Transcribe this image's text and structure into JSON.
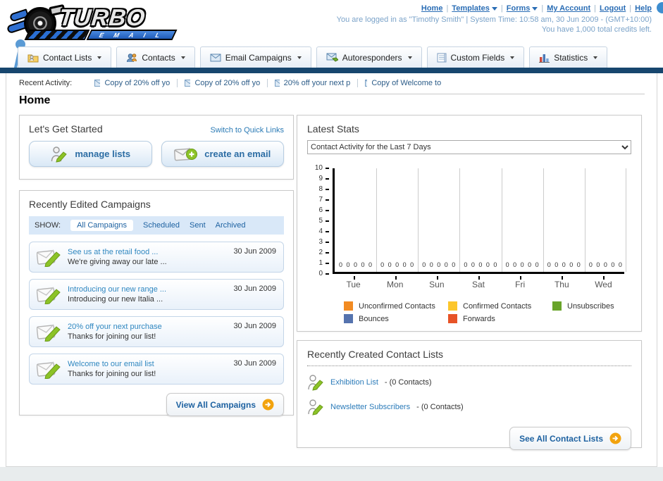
{
  "header": {
    "logo": {
      "title": "TURBO",
      "subtitle": "E M A I L"
    },
    "nav_links": [
      {
        "label": "Home"
      },
      {
        "label": "Templates",
        "dropdown": true
      },
      {
        "label": "Forms",
        "dropdown": true
      },
      {
        "label": "My Account"
      },
      {
        "label": "Logout"
      },
      {
        "label": "Help"
      }
    ],
    "separator": "|",
    "login_info": "You are logged in as \"Timothy Smith\" | System Time: 10:58 am, 30 Jun 2009 - (GMT+10:00)",
    "credits_info": "You have 1,000 total credits left."
  },
  "nav_tabs": [
    {
      "label": "Contact Lists",
      "icon": "contact-lists-folder-icon"
    },
    {
      "label": "Contacts",
      "icon": "contacts-people-icon"
    },
    {
      "label": "Email Campaigns",
      "icon": "email-envelope-icon"
    },
    {
      "label": "Autoresponders",
      "icon": "autoresponder-envelope-icon"
    },
    {
      "label": "Custom Fields",
      "icon": "custom-fields-document-icon"
    },
    {
      "label": "Statistics",
      "icon": "statistics-barchart-icon"
    }
  ],
  "recent_activity": {
    "label": "Recent Activity:",
    "items": [
      {
        "text": "Copy of 20% off yo"
      },
      {
        "text": "Copy of 20% off yo"
      },
      {
        "text": "20% off your next p"
      },
      {
        "text": "Copy of Welcome to"
      }
    ]
  },
  "page_title": "Home",
  "get_started": {
    "title": "Let's Get Started",
    "switch_link": "Switch to Quick Links",
    "buttons": [
      {
        "label": "manage lists",
        "icon": "person-pencil-icon"
      },
      {
        "label": "create an email",
        "icon": "envelope-plus-icon"
      }
    ]
  },
  "campaigns": {
    "title": "Recently Edited Campaigns",
    "show_label": "SHOW:",
    "filters": [
      {
        "label": "All Campaigns",
        "active": true
      },
      {
        "label": "Scheduled",
        "active": false
      },
      {
        "label": "Sent",
        "active": false
      },
      {
        "label": "Archived",
        "active": false
      }
    ],
    "items": [
      {
        "title": "See us at the retail food ...",
        "subtitle": "We're giving away our late ...",
        "date": "30 Jun 2009"
      },
      {
        "title": "Introducing our new range ...",
        "subtitle": "Introducing our new Italia ...",
        "date": "30 Jun 2009"
      },
      {
        "title": "20% off your next purchase",
        "subtitle": "Thanks for joining our list!",
        "date": "30 Jun 2009"
      },
      {
        "title": "Welcome to our email list",
        "subtitle": "Thanks for joining our list!",
        "date": "30 Jun 2009"
      }
    ],
    "view_all_label": "View All Campaigns"
  },
  "latest_stats": {
    "title": "Latest Stats",
    "selected_option": "Contact Activity for the Last 7 Days"
  },
  "chart_data": {
    "type": "bar",
    "title": "Contact Activity for the Last 7 Days",
    "categories": [
      "Tue",
      "Mon",
      "Sun",
      "Sat",
      "Fri",
      "Thu",
      "Wed"
    ],
    "series": [
      {
        "name": "Unconfirmed Contacts",
        "color": "#f28b22",
        "values": [
          0,
          0,
          0,
          0,
          0,
          0,
          0
        ]
      },
      {
        "name": "Confirmed Contacts",
        "color": "#fcc62c",
        "values": [
          0,
          0,
          0,
          0,
          0,
          0,
          0
        ]
      },
      {
        "name": "Unsubscribes",
        "color": "#69a42a",
        "values": [
          0,
          0,
          0,
          0,
          0,
          0,
          0
        ]
      },
      {
        "name": "Bounces",
        "color": "#5573ae",
        "values": [
          0,
          0,
          0,
          0,
          0,
          0,
          0
        ]
      },
      {
        "name": "Forwards",
        "color": "#e75327",
        "values": [
          0,
          0,
          0,
          0,
          0,
          0,
          0
        ]
      }
    ],
    "xlabel": "",
    "ylabel": "",
    "ylim": [
      0,
      10
    ],
    "yticks": [
      0,
      1,
      2,
      3,
      4,
      5,
      6,
      7,
      8,
      9,
      10
    ],
    "grid": "vertical category separators",
    "legend_position": "bottom"
  },
  "contact_lists": {
    "title": "Recently Created Contact Lists",
    "items": [
      {
        "name": "Exhibition List",
        "detail": "- (0 Contacts)"
      },
      {
        "name": "Newsletter Subscribers",
        "detail": "- (0 Contacts)"
      }
    ],
    "see_all_label": "See All Contact Lists"
  },
  "colors": {
    "navy_bar": "#17466e",
    "link_blue": "#2a6db5",
    "accent_orange": "#f2a30e"
  }
}
